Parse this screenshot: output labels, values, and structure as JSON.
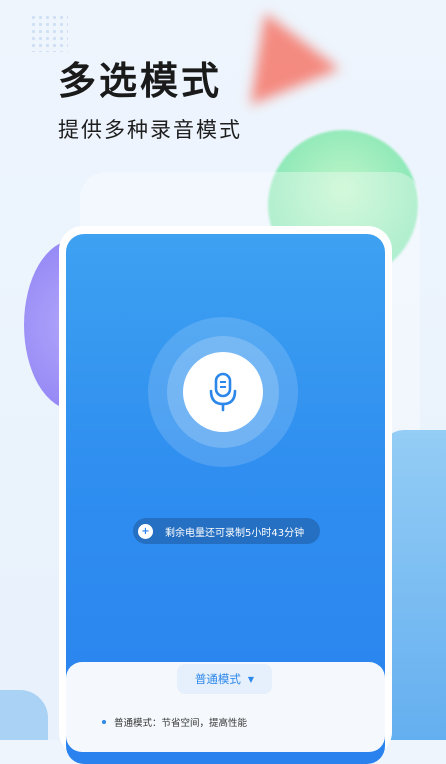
{
  "header": {
    "title": "多选模式",
    "subtitle": "提供多种录音模式"
  },
  "recorder": {
    "mic_icon": "microphone-icon",
    "battery_icon": "plus-circle-icon",
    "battery_text": "剩余电量还可录制5小时43分钟"
  },
  "mode_panel": {
    "selected_mode": "普通模式",
    "dropdown_icon": "caret-down-icon",
    "description": "普通模式：节省空间，提高性能"
  },
  "colors": {
    "accent": "#2c87ea",
    "screen_top": "#3ea1f1",
    "screen_bottom": "#2a82ee"
  }
}
